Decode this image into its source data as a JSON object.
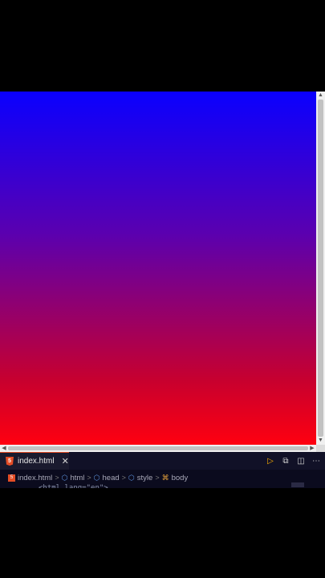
{
  "preview": {
    "gradient": {
      "top_color": "#0a00ff",
      "bottom_color": "#ff0010",
      "direction": "to bottom"
    },
    "scrollbar_up_icon": "triangle-up",
    "scrollbar_down_icon": "triangle-down"
  },
  "editor": {
    "tab": {
      "label": "index.html",
      "icon": "html5-icon",
      "close_glyph": "✕"
    },
    "actions": [
      {
        "name": "run-icon",
        "glyph": "▷"
      },
      {
        "name": "preview-split-icon",
        "glyph": "⧉"
      },
      {
        "name": "split-editor-icon",
        "glyph": "◫"
      },
      {
        "name": "more-icon",
        "glyph": "⋯"
      }
    ],
    "breadcrumb": {
      "file": "index.html",
      "items": [
        "html",
        "head",
        "style",
        "body"
      ],
      "separator": ">"
    },
    "code_peek": "<html lang=\"en\">"
  }
}
